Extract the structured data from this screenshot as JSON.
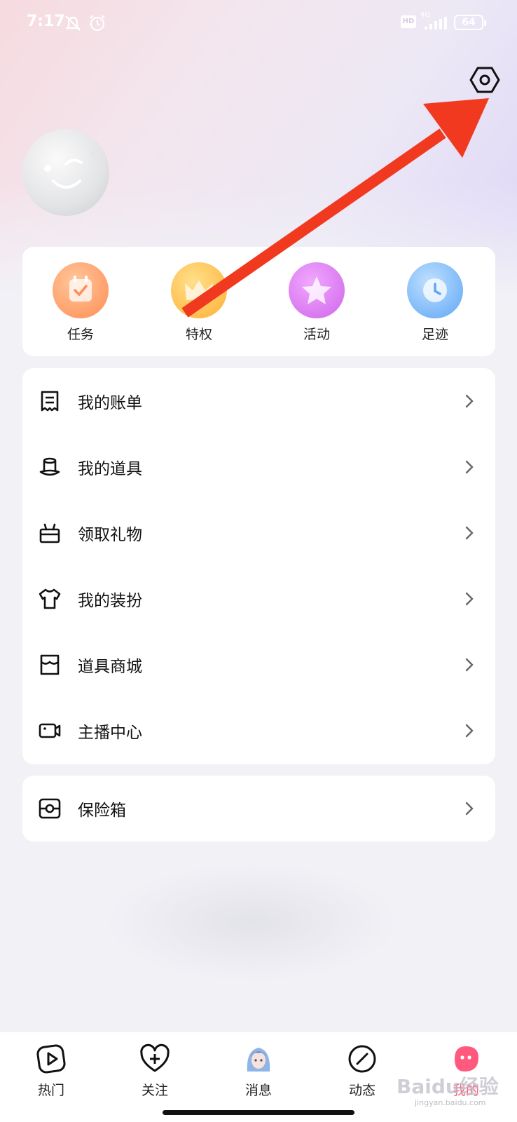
{
  "status_bar": {
    "time": "7:17",
    "hd_badge": "HD",
    "network": "4G",
    "battery": "64"
  },
  "header": {
    "settings_icon": "hexagon-settings-icon",
    "avatar_icon": "winking-face-avatar"
  },
  "quick_actions": [
    {
      "label": "任务",
      "icon": "calendar-check-icon",
      "color": "#ff9a66"
    },
    {
      "label": "特权",
      "icon": "crown-icon",
      "color": "#ffbe4a"
    },
    {
      "label": "活动",
      "icon": "star-icon",
      "color": "#d679ee"
    },
    {
      "label": "足迹",
      "icon": "clock-icon",
      "color": "#6fb2f8"
    }
  ],
  "menu": [
    {
      "label": "我的账单",
      "icon": "bill-icon"
    },
    {
      "label": "我的道具",
      "icon": "hat-icon"
    },
    {
      "label": "领取礼物",
      "icon": "gift-icon"
    },
    {
      "label": "我的装扮",
      "icon": "shirt-icon"
    },
    {
      "label": "道具商城",
      "icon": "store-icon"
    },
    {
      "label": "主播中心",
      "icon": "video-camera-icon"
    }
  ],
  "safe": {
    "label": "保险箱",
    "icon": "safe-icon"
  },
  "tabs": [
    {
      "label": "热门",
      "icon": "play-icon"
    },
    {
      "label": "关注",
      "icon": "heart-plus-icon"
    },
    {
      "label": "消息",
      "icon": "anime-avatar-icon"
    },
    {
      "label": "动态",
      "icon": "slash-circle-icon"
    },
    {
      "label": "我的",
      "icon": "pink-blob-icon",
      "active": true
    }
  ],
  "watermark": {
    "text": "Baidu经验",
    "sub": "jingyan.baidu.com"
  },
  "colors": {
    "annotation_arrow": "#f0391e",
    "active_tab": "#ff5a7e"
  }
}
